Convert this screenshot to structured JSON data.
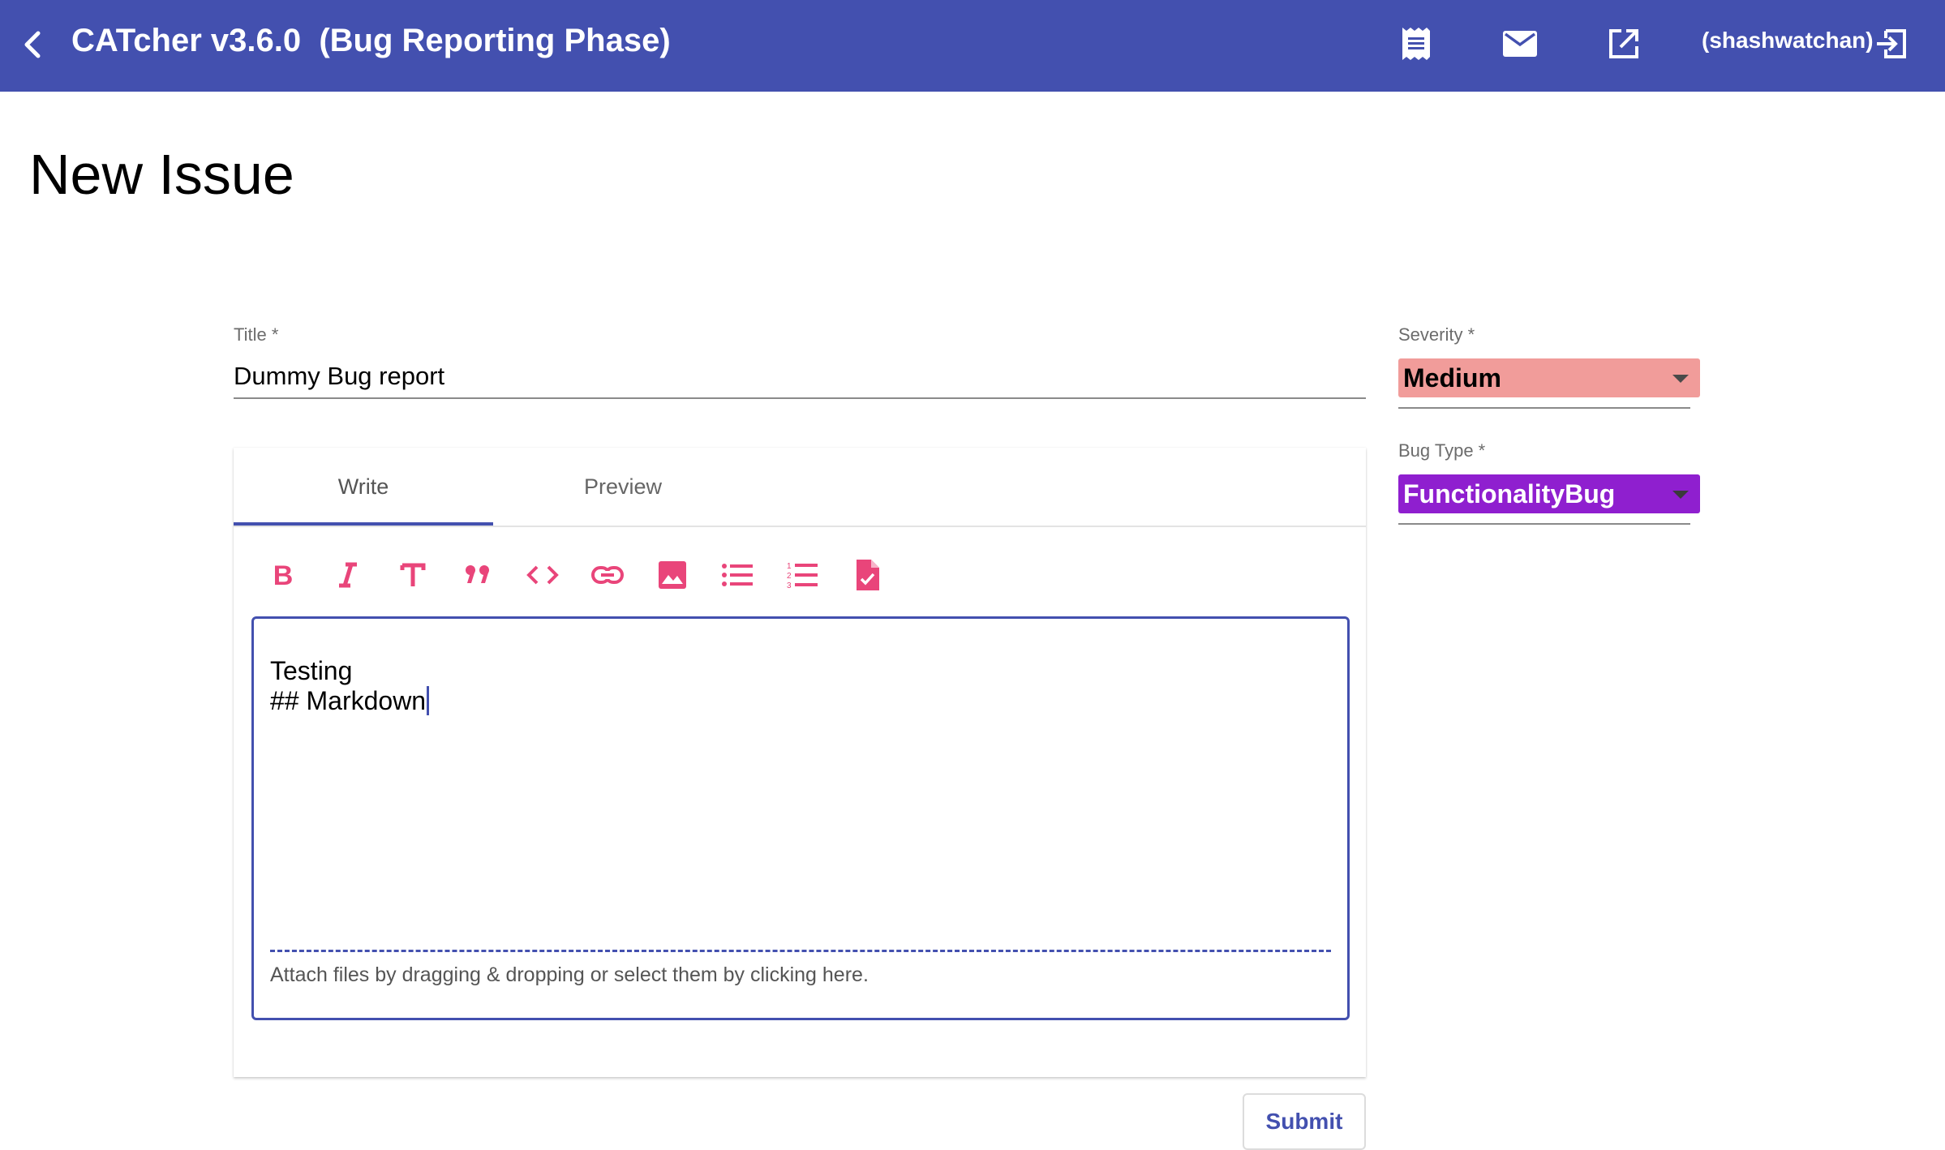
{
  "toolbar": {
    "title": "CATcher v3.6.0  (Bug Reporting Phase)",
    "user": "(shashwatchan)",
    "icons": [
      "back-arrow-icon",
      "issue-list-icon",
      "mail-icon",
      "open-in-new-icon",
      "logout-icon"
    ]
  },
  "page": {
    "heading": "New Issue"
  },
  "form": {
    "title_label": "Title *",
    "title_value": "Dummy Bug report",
    "tabs": [
      "Write",
      "Preview"
    ],
    "active_tab": "Write",
    "formatting_buttons": [
      "bold",
      "italic",
      "heading",
      "quote",
      "code",
      "link",
      "image",
      "bulleted-list",
      "numbered-list",
      "task-list"
    ],
    "description_lines": [
      "Testing",
      "## Markdown"
    ],
    "attach_hint": "Attach files by dragging & dropping or select them by clicking here.",
    "submit_label": "Submit"
  },
  "severity": {
    "label": "Severity *",
    "value": "Medium",
    "color": "#f19c9a"
  },
  "bug_type": {
    "label": "Bug Type *",
    "value": "FunctionalityBug",
    "color": "#8f1fcf"
  },
  "colors": {
    "primary": "#4350af",
    "accent": "#e9457a"
  }
}
